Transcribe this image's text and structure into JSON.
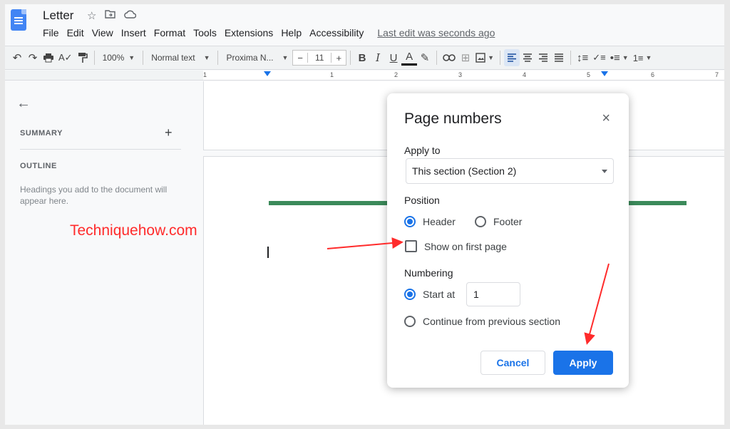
{
  "header": {
    "title": "Letter",
    "icons": [
      "star-icon",
      "folder-move-icon",
      "cloud-icon"
    ],
    "menu": [
      "File",
      "Edit",
      "View",
      "Insert",
      "Format",
      "Tools",
      "Extensions",
      "Help",
      "Accessibility"
    ],
    "last_edit": "Last edit was seconds ago"
  },
  "toolbar": {
    "zoom": "100%",
    "style": "Normal text",
    "font": "Proxima N...",
    "font_size": "11",
    "minus": "−",
    "plus": "+"
  },
  "ruler": {
    "numbers": [
      "1",
      "1",
      "2",
      "3",
      "4",
      "5",
      "6",
      "7"
    ]
  },
  "sidebar": {
    "summary": "SUMMARY",
    "add": "+",
    "outline": "OUTLINE",
    "outline_hint": "Headings you add to the document will appear here."
  },
  "watermark": "Techniquehow.com",
  "dialog": {
    "title": "Page numbers",
    "close": "×",
    "apply_to_label": "Apply to",
    "apply_to_value": "This section (Section 2)",
    "position_label": "Position",
    "header_option": "Header",
    "footer_option": "Footer",
    "position_selected": "Header",
    "show_first_page": "Show on first page",
    "show_first_page_checked": false,
    "numbering_label": "Numbering",
    "start_at_label": "Start at",
    "start_at_value": "1",
    "continue_label": "Continue from previous section",
    "numbering_selected": "Start at",
    "cancel": "Cancel",
    "apply": "Apply"
  },
  "colors": {
    "accent": "#1a73e8",
    "annotation": "#ff2b2b",
    "header_bar": "#3b8a5a"
  }
}
